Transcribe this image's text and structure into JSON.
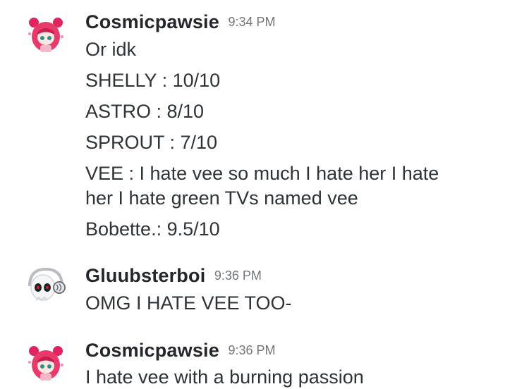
{
  "messages": [
    {
      "username": "Cosmicpawsie",
      "timestamp": "9:34 PM",
      "avatar_icon": "pink-haired-anime-girl-avatar",
      "lines": [
        "Or idk",
        "SHELLY : 10/10",
        "ASTRO : 8/10",
        "SPROUT : 7/10",
        "VEE : I hate vee so much I hate her I hate",
        "her I hate green TVs named vee",
        "Bobette.: 9.5/10"
      ]
    },
    {
      "username": "Gluubsterboi",
      "timestamp": "9:36 PM",
      "avatar_icon": "white-skull-headphones-avatar",
      "lines": [
        "OMG I HATE VEE TOO-"
      ]
    },
    {
      "username": "Cosmicpawsie",
      "timestamp": "9:36 PM",
      "avatar_icon": "pink-haired-anime-girl-avatar",
      "lines": [
        "I hate vee with a burning passion"
      ]
    }
  ],
  "colors": {
    "background": "#ffffff",
    "username": "#23262a",
    "timestamp": "#72767d",
    "text": "#2e3338"
  }
}
